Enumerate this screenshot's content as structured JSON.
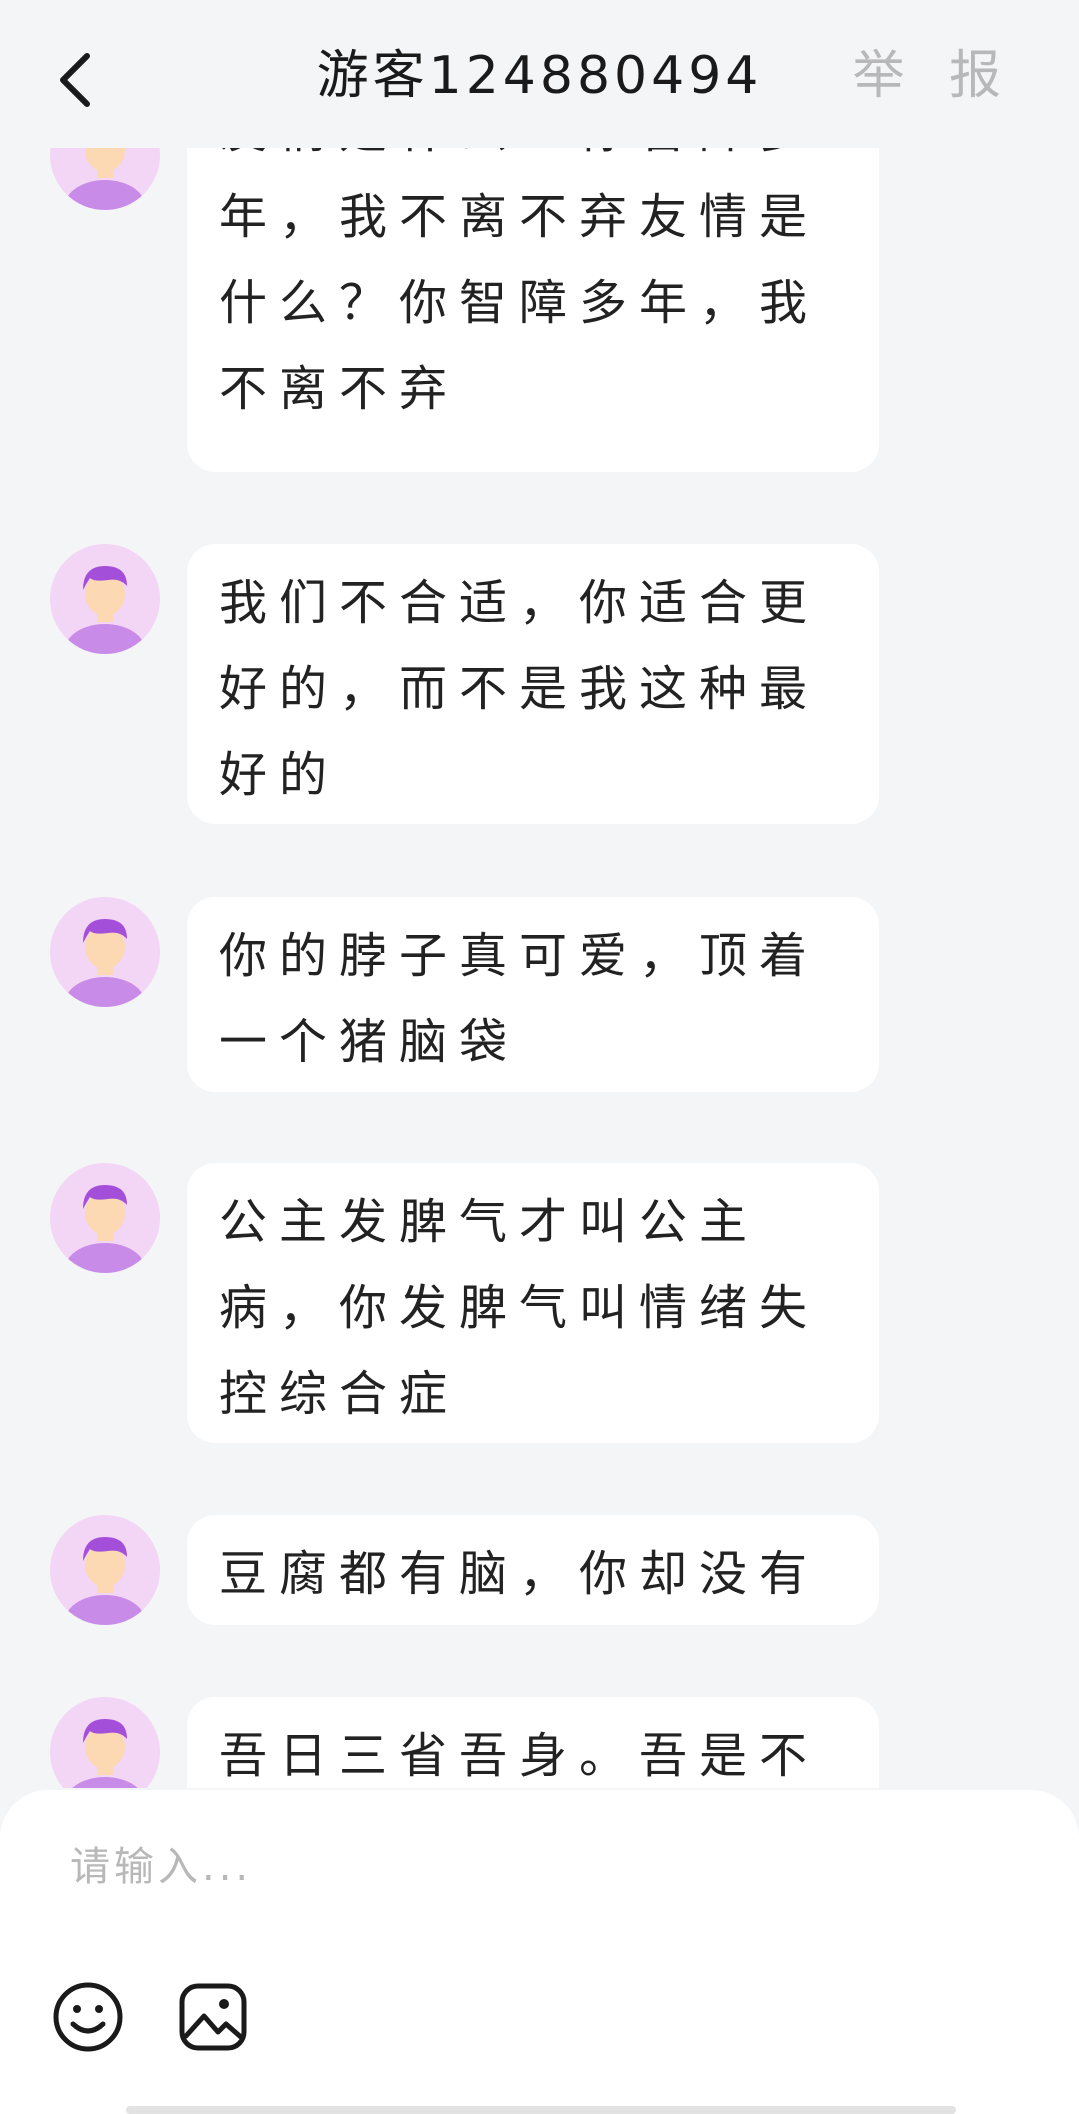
{
  "header": {
    "title": "游客124880494",
    "report_label": "举 报"
  },
  "messages": [
    {
      "text": "友情是什么？你智障多年，我不离不弃友情是什么？你智障多年，我不离不弃"
    },
    {
      "text": "我们不合适，你适合更好的，而不是我这种最好的"
    },
    {
      "text": "你的脖子真可爱，顶着一个猪脑袋"
    },
    {
      "text": "公主发脾气才叫公主病，你发脾气叫情绪失控综合症"
    },
    {
      "text": "豆腐都有脑，你却没有"
    },
    {
      "text": "吾日三省吾身。吾是不"
    }
  ],
  "input": {
    "placeholder": "请输入..."
  },
  "toolbar": {
    "emoji_icon": "smiley-icon",
    "image_icon": "image-icon"
  },
  "colors": {
    "background": "#f4f5f7",
    "bubble": "#ffffff",
    "avatar_bg": "#f3d5f5",
    "avatar_hair": "#a44fd9",
    "avatar_body": "#c88ce8",
    "avatar_face": "#fcd9b3"
  }
}
